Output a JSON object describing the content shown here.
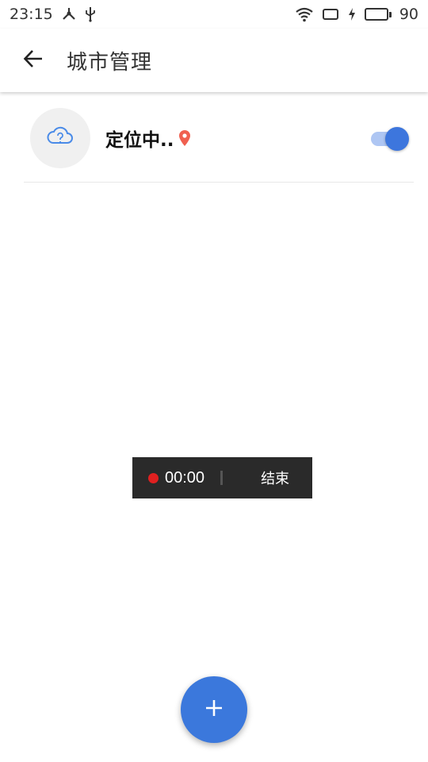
{
  "status_bar": {
    "time": "23:15",
    "battery_level": "90",
    "battery_color": "#31c534",
    "left_icons": [
      "network-share-icon",
      "usb-icon"
    ],
    "right_icons": [
      "wifi-icon",
      "screen-rotate-icon",
      "charging-icon",
      "battery-icon"
    ]
  },
  "app_bar": {
    "back_icon": "arrow-left-icon",
    "title": "城市管理"
  },
  "cities": [
    {
      "weather_icon": "cloud-question-icon",
      "name": "定位中..",
      "location_icon": "location-pin-icon",
      "location_icon_color": "#f06050",
      "toggle_on": true
    }
  ],
  "recording": {
    "time": "00:00",
    "end_label": "结束",
    "dot_color": "#e02020"
  },
  "fab": {
    "icon": "plus-icon",
    "color": "#3b78dc"
  },
  "accent": "#3d76dd"
}
